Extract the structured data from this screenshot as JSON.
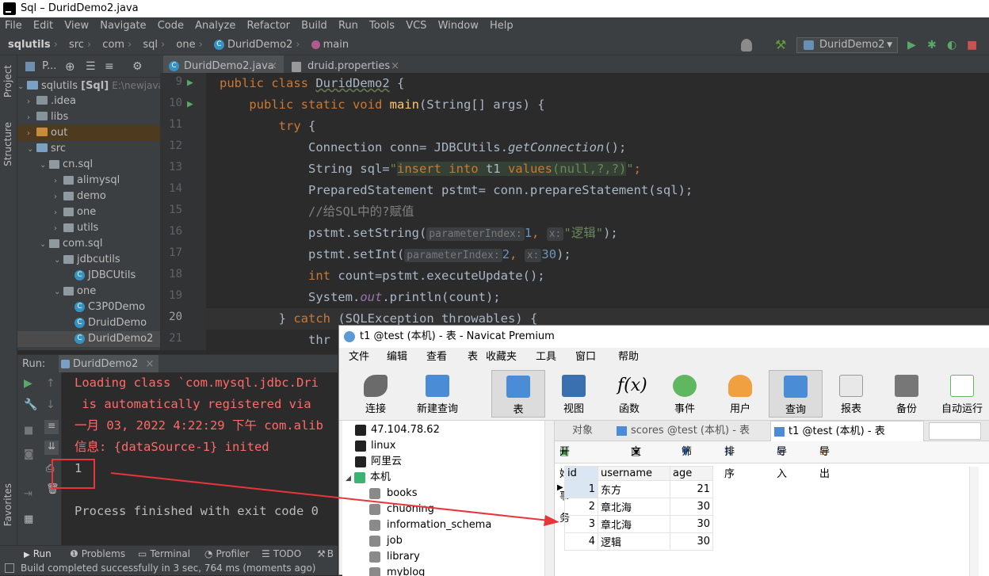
{
  "window": {
    "title": "Sql – DuridDemo2.java"
  },
  "menu": [
    "File",
    "Edit",
    "View",
    "Navigate",
    "Code",
    "Analyze",
    "Refactor",
    "Build",
    "Run",
    "Tools",
    "VCS",
    "Window",
    "Help"
  ],
  "breadcrumb": [
    "sqlutils",
    "src",
    "com",
    "sql",
    "one",
    "DuridDemo2",
    "main"
  ],
  "run_config": "DuridDemo2",
  "sidebar": {
    "project": "Project",
    "structure": "Structure",
    "favorites": "Favorites"
  },
  "project": {
    "header": "P...",
    "root_name": "sqlutils",
    "root_module": "[Sql]",
    "root_path": "E:\\newjavacod",
    "items": [
      ".idea",
      "libs",
      "out",
      "src",
      "cn.sql",
      "alimysql",
      "demo",
      "one",
      "utils",
      "com.sql",
      "jdbcutils",
      "JDBCUtils",
      "one",
      "C3P0Demo",
      "DruidDemo",
      "DuridDemo2"
    ]
  },
  "editor": {
    "tabs": [
      "DuridDemo2.java",
      "druid.properties"
    ],
    "line_numbers": [
      "9",
      "10",
      "11",
      "12",
      "13",
      "14",
      "15",
      "16",
      "17",
      "18",
      "19",
      "20",
      "21"
    ],
    "code": {
      "l9a": "public class ",
      "l9b": "DuridDemo2",
      "l9c": " {",
      "l10a": "    public static void ",
      "l10b": "main",
      "l10c": "(String[] args) {",
      "l11a": "        try",
      "l11b": " {",
      "l12a": "            Connection conn= JDBCUtils.",
      "l12b": "getConnection",
      "l12c": "();",
      "l13a": "            String sql=",
      "l13b": "\"",
      "l13c": "insert into",
      "l13d": " t1 ",
      "l13e": "values",
      "l13f": "(null,?,?)",
      "l13g": "\"",
      "l13h": ";",
      "l14": "            PreparedStatement pstmt= conn.prepareStatement(sql);",
      "l15": "            //给SQL中的?赋值",
      "l16a": "            pstmt.setString(",
      "l16h1": "parameterIndex:",
      "l16n": "1",
      "l16c": ",",
      "l16h2": "x:",
      "l16s": "\"逻辑\"",
      "l16e": ");",
      "l17a": "            pstmt.setInt(",
      "l17h1": "parameterIndex:",
      "l17n": "2",
      "l17c": ",",
      "l17h2": "x:",
      "l17v": "30",
      "l17e": ");",
      "l18a": "            ",
      "l18b": "int",
      "l18c": " count=pstmt.executeUpdate();",
      "l19a": "            System.",
      "l19b": "out",
      "l19c": ".println(count);",
      "l20a": "        } ",
      "l20b": "catch",
      "l20c": " (SQLException throwables) {",
      "l21": "            thr"
    }
  },
  "run_panel": {
    "label": "Run:",
    "tab": "DuridDemo2",
    "console": [
      "Loading class `com.mysql.jdbc.Dri",
      " is automatically registered via",
      "一月 03, 2022 4:22:29 下午 com.alib",
      "信息: {dataSource-1} inited",
      "1",
      "",
      "Process finished with exit code 0"
    ]
  },
  "bottom_tabs": [
    "Run",
    "Problems",
    "Terminal",
    "Profiler",
    "TODO",
    "B"
  ],
  "status": "Build completed successfully in 3 sec, 764 ms (moments ago)",
  "navicat": {
    "title": "t1 @test (本机) - 表 - Navicat Premium",
    "menu": [
      "文件",
      "编辑",
      "查看",
      "表",
      "收藏夹",
      "工具",
      "窗口",
      "帮助"
    ],
    "toolbar": [
      "连接",
      "新建查询",
      "表",
      "视图",
      "函数",
      "事件",
      "用户",
      "查询",
      "报表",
      "备份",
      "自动运行"
    ],
    "connections": [
      "47.104.78.62",
      "linux",
      "阿里云",
      "本机"
    ],
    "databases": [
      "books",
      "chuoning",
      "information_schema",
      "job",
      "library",
      "myblog"
    ],
    "tabs": [
      "对象",
      "scores @test (本机) - 表",
      "t1 @test (本机) - 表"
    ],
    "subtoolbar": [
      "开始事务",
      "文本",
      "筛选",
      "排序",
      "导入",
      "导出"
    ],
    "columns": [
      "id",
      "username",
      "age"
    ],
    "rows": [
      {
        "id": "1",
        "username": "东方",
        "age": "21"
      },
      {
        "id": "2",
        "username": "章北海",
        "age": "30"
      },
      {
        "id": "3",
        "username": "章北海",
        "age": "30"
      },
      {
        "id": "4",
        "username": "逻辑",
        "age": "30"
      }
    ]
  },
  "colors": {
    "ide_bg": "#2b2b2b",
    "panel": "#3c3f41",
    "keyword": "#cc7832",
    "string": "#6a8759",
    "error_text": "#ff6b68",
    "annotation": "#e8353a"
  }
}
